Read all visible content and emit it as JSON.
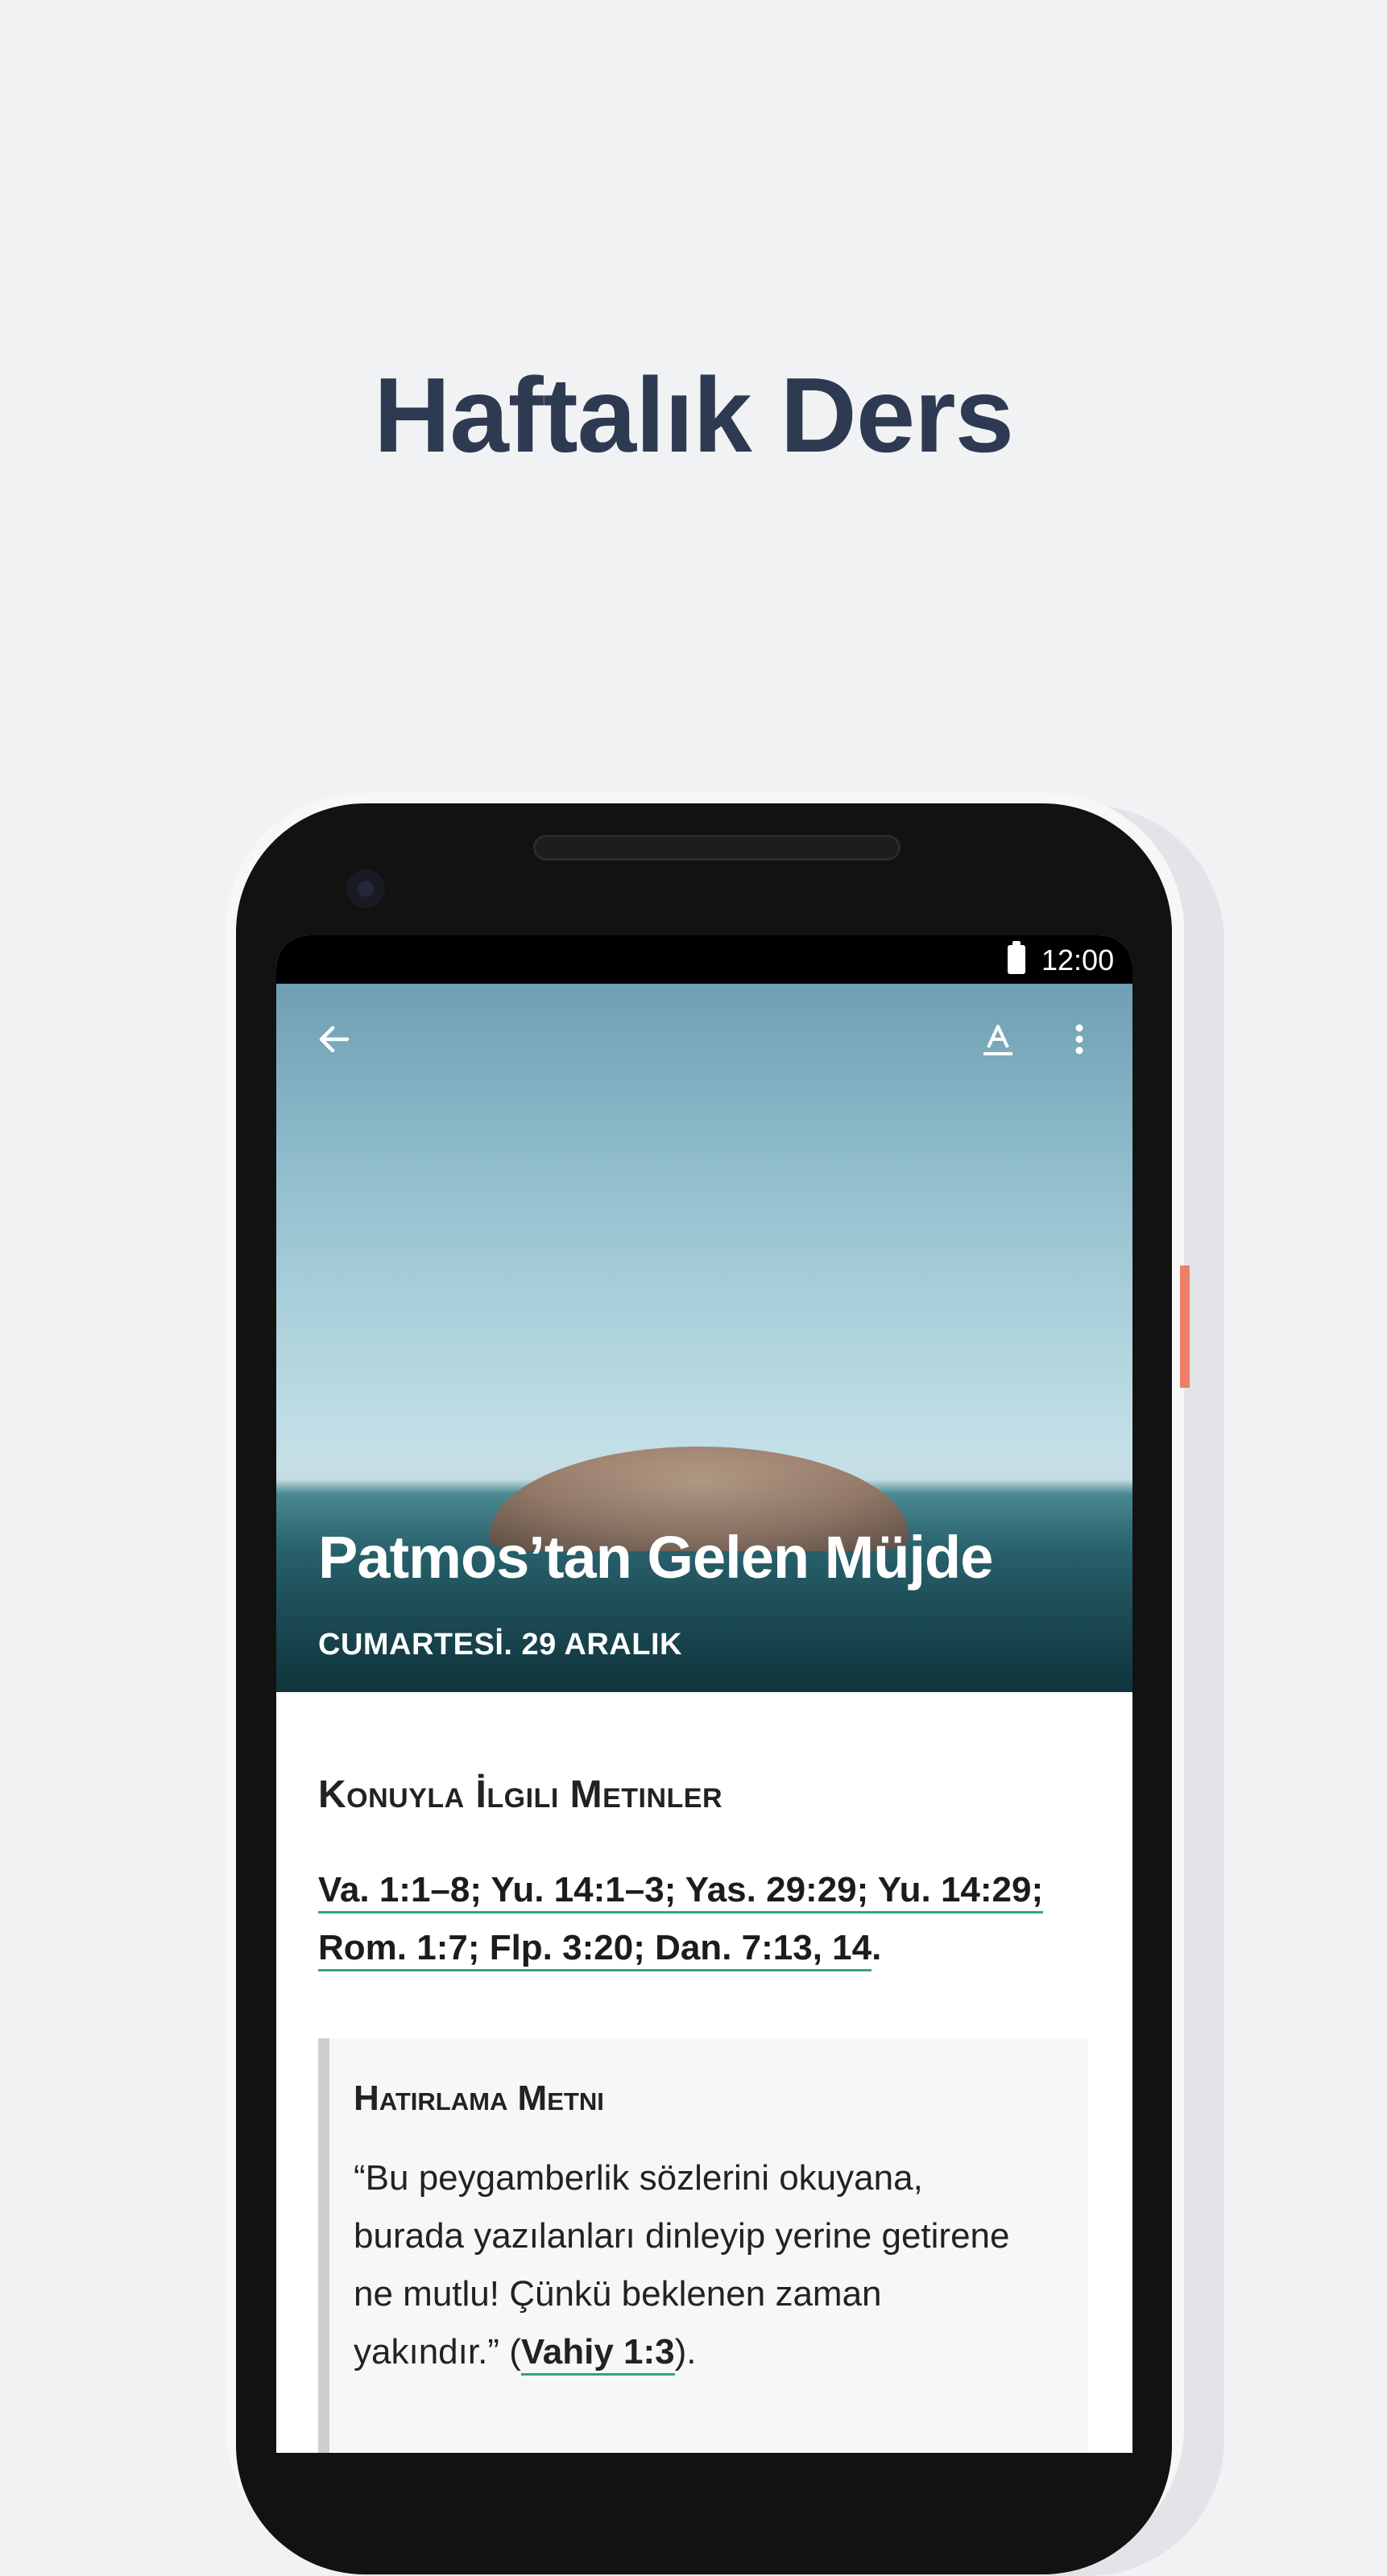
{
  "headline": "Haftalık Ders",
  "status_bar": {
    "time": "12:00"
  },
  "toolbar": {
    "back_icon": "arrow-left-icon",
    "font_icon": "text-format-icon",
    "more_icon": "more-vert-icon"
  },
  "lesson": {
    "title": "Patmos’tan Gelen Müjde",
    "date": "CUMARTESİ. 29 ARALIK"
  },
  "related_texts": {
    "title": "Konuyla İlgili Metinler",
    "line1": "Va. 1:1–8; Yu. 14:1–3; Yas. 29:29; Yu. 14:29;",
    "line2": "Rom. 1:7; Flp. 3:20; Dan. 7:13, 14",
    "line2_end": "."
  },
  "memory_text": {
    "title": "Hatırlama Metni",
    "line1": "“Bu peygamberlik sözlerini okuyana,",
    "line2": "burada yazılanları dinleyip yerine getirene",
    "line3": "ne mutlu! Çünkü beklenen zaman",
    "line4_start": "yakındır.” (",
    "reference": "Vahiy 1:3",
    "line4_end": ")."
  },
  "colors": {
    "headline": "#2e3a52",
    "link_underline": "#35a678",
    "power_button": "#ef7f68"
  }
}
